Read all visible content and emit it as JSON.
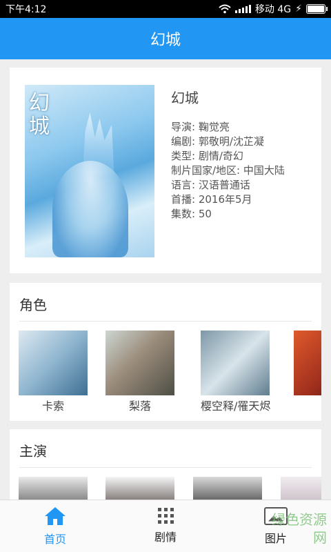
{
  "status": {
    "time": "下午4:12",
    "carrier": "移动 4G"
  },
  "appbar": {
    "title": "幻城"
  },
  "movie": {
    "poster_text": "幻城",
    "title": "幻城",
    "details": [
      "导演: 鞠觉亮",
      "编剧: 郭敬明/沈芷凝",
      "类型: 剧情/奇幻",
      "制片国家/地区: 中国大陆",
      "语言: 汉语普通话",
      "首播: 2016年5月",
      "集数: 50"
    ]
  },
  "roles": {
    "title": "角色",
    "items": [
      {
        "name": "卡索"
      },
      {
        "name": "梨落"
      },
      {
        "name": "樱空释/罹天烬"
      },
      {
        "name": ""
      }
    ]
  },
  "cast": {
    "title": "主演"
  },
  "nav": {
    "items": [
      {
        "label": "首页"
      },
      {
        "label": "剧情"
      },
      {
        "label": "图片"
      }
    ],
    "accent": "#2196f3"
  },
  "watermark": {
    "line1": "绿色资源网",
    "line2": "www.downcc.com"
  }
}
